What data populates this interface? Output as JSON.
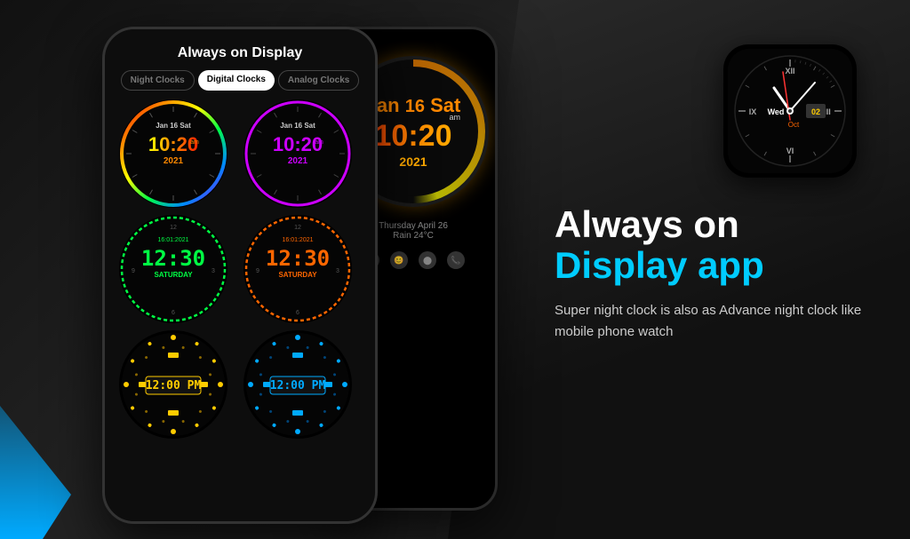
{
  "app": {
    "title": "Always on Display app",
    "headline_line1": "Always on",
    "headline_line2": "Display app",
    "subtitle": "Super night clock is also as Advance night clock like mobile phone watch"
  },
  "phone_header": "Always on Display",
  "tabs": [
    {
      "label": "Night Clocks",
      "active": false
    },
    {
      "label": "Digital Clocks",
      "active": true
    },
    {
      "label": "Analog Clocks",
      "active": false
    }
  ],
  "clocks": [
    {
      "id": "clock1",
      "date": "Jan 16 Sat",
      "time": "10:20",
      "suffix": "am",
      "year": "2021",
      "style": "rainbow"
    },
    {
      "id": "clock2",
      "date": "Jan 16 Sat",
      "time": "10:20",
      "suffix": "am",
      "year": "2021",
      "style": "purple"
    },
    {
      "id": "clock3",
      "date": "16:01:2021",
      "time": "12:30",
      "label": "SATURDAY",
      "style": "green-digital"
    },
    {
      "id": "clock4",
      "date": "16:01:2021",
      "time": "12:30",
      "label": "SATURDAY",
      "style": "orange-digital"
    },
    {
      "id": "clock5",
      "time": "12:00",
      "suffix": "PM",
      "style": "dot-yellow"
    },
    {
      "id": "clock6",
      "time": "12:00",
      "suffix": "PM",
      "style": "dot-blue"
    }
  ],
  "large_clock": {
    "date_prefix": "Jan",
    "day_num": "16",
    "day_name": "Sat",
    "time": "10:20",
    "suffix": "am",
    "year": "2021"
  },
  "weather": {
    "line1": "Thursday April 26",
    "line2": "Rain 24°C"
  },
  "square_watch": {
    "day": "Wed",
    "date": "02",
    "month": "Oct",
    "numerals": [
      "XII",
      "III",
      "VI",
      "IX"
    ]
  },
  "colors": {
    "rainbow_start": "#ff0000",
    "accent_cyan": "#00ccff",
    "accent_orange": "#ff8800",
    "bg_dark": "#111111"
  }
}
